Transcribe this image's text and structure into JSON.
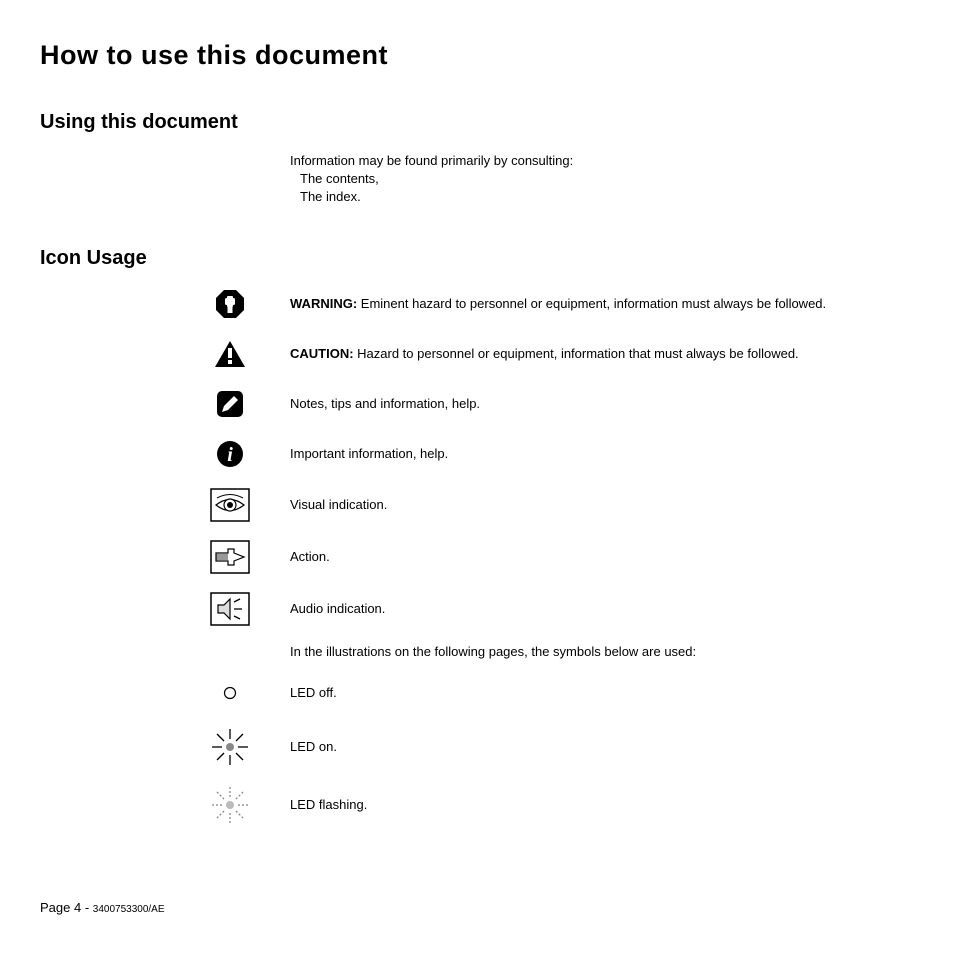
{
  "title": "How to use this document",
  "section1": {
    "heading": "Using this document",
    "intro": "Information may be found primarily by consulting:",
    "items": [
      "The contents,",
      "The index."
    ]
  },
  "section2": {
    "heading": "Icon Usage",
    "rows": [
      {
        "bold": "WARNING:",
        "text": " Eminent hazard to personnel or equipment, information must always be followed."
      },
      {
        "bold": "CAUTION:",
        "text": " Hazard to personnel or equipment, information that must always be followed."
      },
      {
        "text": "Notes, tips and information, help."
      },
      {
        "text": "Important information, help."
      },
      {
        "text": "Visual indication."
      },
      {
        "text": "Action."
      },
      {
        "text": "Audio indication."
      }
    ],
    "note": "In the illustrations on the following pages, the symbols below are used:",
    "led_rows": [
      {
        "text": "LED off."
      },
      {
        "text": "LED on."
      },
      {
        "text": "LED flashing."
      }
    ]
  },
  "footer": {
    "page": "Page 4 - ",
    "code": "3400753300/AE"
  }
}
